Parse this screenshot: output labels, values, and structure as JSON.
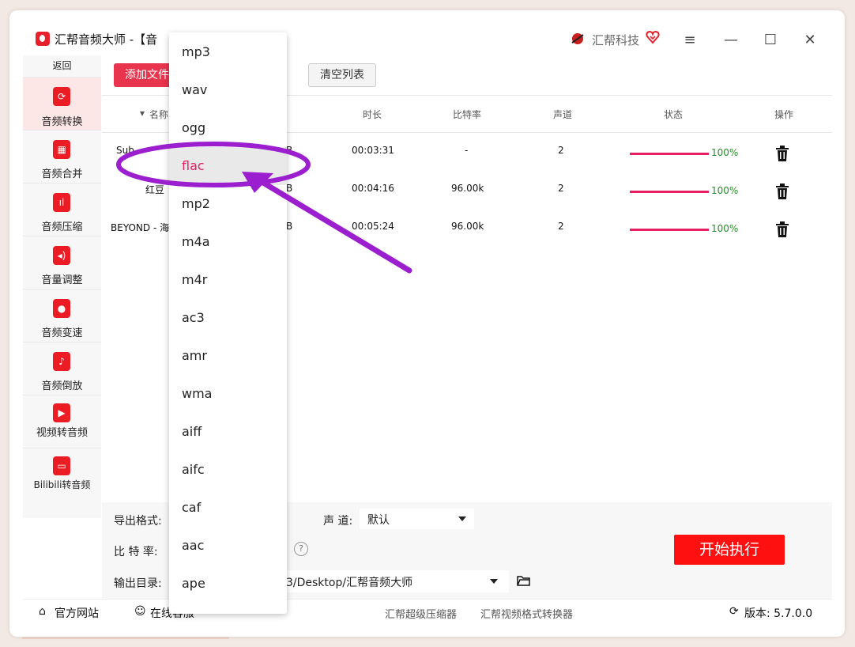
{
  "window": {
    "title": "汇帮音频大师 -【音",
    "brand": "汇帮科技",
    "controls": [
      "≡",
      "—",
      "☐",
      "✕"
    ]
  },
  "sidebar": {
    "back": "返回",
    "items": [
      {
        "label": "音频转换",
        "icon": "audio-convert-icon"
      },
      {
        "label": "音频合并",
        "icon": "audio-merge-icon"
      },
      {
        "label": "音频压缩",
        "icon": "audio-compress-icon"
      },
      {
        "label": "音量调整",
        "icon": "volume-icon"
      },
      {
        "label": "音频变速",
        "icon": "microphone-icon"
      },
      {
        "label": "音频倒放",
        "icon": "music-note-icon"
      },
      {
        "label": "视频转音频",
        "icon": "video-film-icon"
      },
      {
        "label": "Bilibili转音频",
        "icon": "bilibili-tv-icon"
      }
    ]
  },
  "toolbar": {
    "add_label": "添加文件",
    "clear_label": "清空列表"
  },
  "table": {
    "headers": {
      "name": "名称",
      "duration": "时长",
      "bitrate": "比特率",
      "channels": "声道",
      "status": "状态",
      "action": "操作"
    },
    "rows": [
      {
        "name": "Sub",
        "size": "B",
        "duration": "00:03:31",
        "bitrate": "-",
        "channels": "2",
        "progress": "100%"
      },
      {
        "name": "红豆",
        "size": "B",
        "duration": "00:04:16",
        "bitrate": "96.00k",
        "channels": "2",
        "progress": "100%"
      },
      {
        "name": "BEYOND - 海",
        "size": "B",
        "duration": "00:05:24",
        "bitrate": "96.00k",
        "channels": "2",
        "progress": "100%"
      }
    ]
  },
  "settings": {
    "format_label": "导出格式:",
    "bitrate_label": "比 特 率:",
    "channel_label": "声 道:",
    "channel_value": "默认",
    "output_label": "输出目录:",
    "output_path": "3/Desktop/汇帮音频大师",
    "help": "?",
    "start_label": "开始执行"
  },
  "footer": {
    "website": "官方网站",
    "support": "在线客服",
    "compress_app": "汇帮超级压缩器",
    "video_app": "汇帮视频格式转换器",
    "version": "版本: 5.7.0.0"
  },
  "dropdown": {
    "options": [
      "mp3",
      "wav",
      "ogg",
      "flac",
      "mp2",
      "m4a",
      "m4r",
      "ac3",
      "amr",
      "wma",
      "aiff",
      "aifc",
      "caf",
      "aac",
      "ape"
    ],
    "selected": "flac"
  },
  "colors": {
    "accent": "#e91e63",
    "start": "#ff1010",
    "annotation": "#9b1ecf"
  }
}
